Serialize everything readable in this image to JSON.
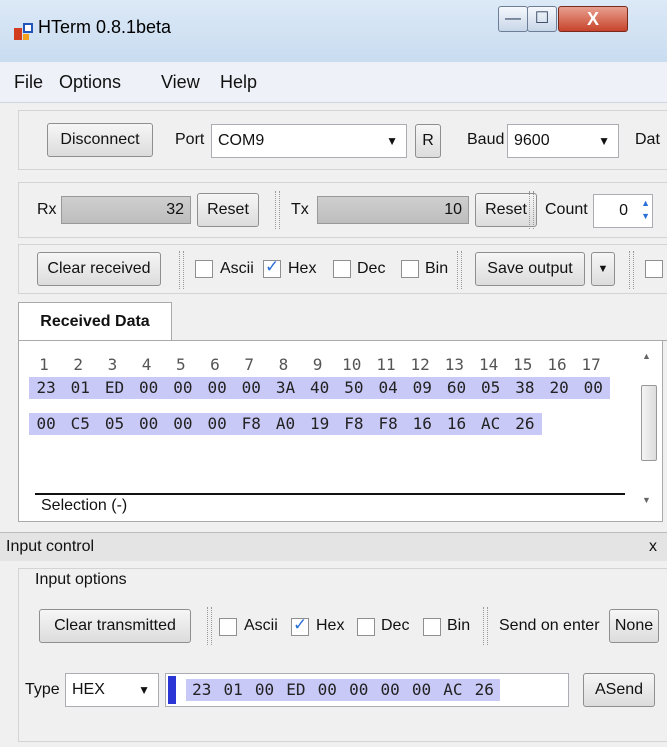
{
  "window": {
    "title": "HTerm 0.8.1beta",
    "min": "—",
    "max": "☐",
    "close": "X"
  },
  "menu": [
    "File",
    "Options",
    "View",
    "Help"
  ],
  "toolbar": {
    "disconnect": "Disconnect",
    "port_label": "Port",
    "port_value": "COM9",
    "r_button": "R",
    "baud_label": "Baud",
    "baud_value": "9600",
    "data_label": "Dat"
  },
  "counters": {
    "rx_label": "Rx",
    "rx_value": "32",
    "rx_reset": "Reset",
    "tx_label": "Tx",
    "tx_value": "10",
    "tx_reset": "Reset",
    "count_label": "Count",
    "count_value": "0"
  },
  "display": {
    "clear_received": "Clear received",
    "ascii": "Ascii",
    "hex": "Hex",
    "dec": "Dec",
    "bin": "Bin",
    "hex_checked": true,
    "save_output": "Save output"
  },
  "received": {
    "tab": "Received Data",
    "column_numbers": [
      "1",
      "2",
      "3",
      "4",
      "5",
      "6",
      "7",
      "8",
      "9",
      "10",
      "11",
      "12",
      "13",
      "14",
      "15",
      "16",
      "17"
    ],
    "rows": [
      [
        "23",
        "01",
        "ED",
        "00",
        "00",
        "00",
        "00",
        "3A",
        "40",
        "50",
        "04",
        "09",
        "60",
        "05",
        "38",
        "20",
        "00"
      ],
      [
        "00",
        "C5",
        "05",
        "00",
        "00",
        "00",
        "F8",
        "A0",
        "19",
        "F8",
        "F8",
        "16",
        "16",
        "AC",
        "26"
      ]
    ],
    "selection": "Selection (-)"
  },
  "input_control": {
    "header": "Input control",
    "close": "x",
    "options_label": "Input options",
    "clear_transmitted": "Clear transmitted",
    "ascii": "Ascii",
    "hex": "Hex",
    "dec": "Dec",
    "bin": "Bin",
    "send_on_enter": "Send on enter",
    "send_on_enter_value": "None",
    "type_label": "Type",
    "type_value": "HEX",
    "input_bytes": [
      "23",
      "01",
      "00",
      "ED",
      "00",
      "00",
      "00",
      "00",
      "AC",
      "26"
    ],
    "asend": "ASend"
  }
}
